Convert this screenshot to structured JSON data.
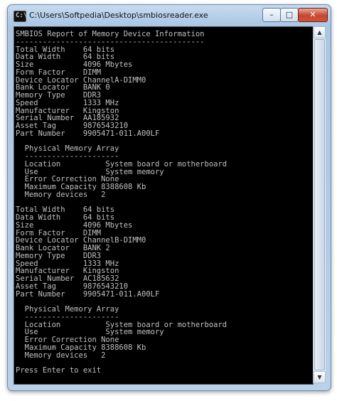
{
  "window": {
    "title": "C:\\Users\\Softpedia\\Desktop\\smbiosreader.exe",
    "icon_glyph": "C:\\",
    "controls": {
      "minimize": "–",
      "maximize": "□",
      "close": "✕"
    }
  },
  "console": {
    "lines": [
      "SMBIOS Report of Memory Device Information",
      "------------------------------------------",
      "Total Width    64 bits",
      "Data Width     64 bits",
      "Size           4096 Mbytes",
      "Form Factor    DIMM",
      "Device Locator ChannelA-DIMM0",
      "Bank Locator   BANK 0",
      "Memory Type    DDR3",
      "Speed          1333 MHz",
      "Manufacturer   Kingston",
      "Serial Number  AA185932",
      "Asset Tag      9876543210",
      "Part Number    9905471-011.A00LF",
      "",
      "  Physical Memory Array",
      "  ---------------------",
      "  Location          System board or motherboard",
      "  Use               System memory",
      "  Error Correction None",
      "  Maximum Capacity 8388608 Kb",
      "  Memory devices   2",
      "",
      "Total Width    64 bits",
      "Data Width     64 bits",
      "Size           4096 Mbytes",
      "Form Factor    DIMM",
      "Device Locator ChannelB-DIMM0",
      "Bank Locator   BANK 2",
      "Memory Type    DDR3",
      "Speed          1333 MHz",
      "Manufacturer   Kingston",
      "Serial Number  AC185632",
      "Asset Tag      9876543210",
      "Part Number    9905471-011.A00LF",
      "",
      "  Physical Memory Array",
      "  ---------------------",
      "  Location          System board or motherboard",
      "  Use               System memory",
      "  Error Correction None",
      "  Maximum Capacity 8388608 Kb",
      "  Memory devices   2",
      "",
      "Press Enter to exit"
    ]
  },
  "scrollbar": {
    "up_arrow": "▲",
    "down_arrow": "▼"
  }
}
